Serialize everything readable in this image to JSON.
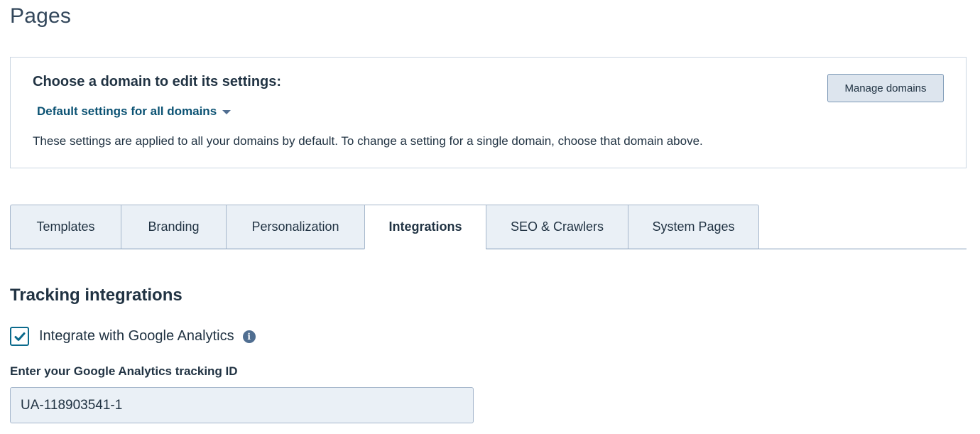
{
  "page": {
    "title": "Pages"
  },
  "domain_card": {
    "heading": "Choose a domain to edit its settings:",
    "selected_domain": "Default settings for all domains",
    "description": "These settings are applied to all your domains by default. To change a setting for a single domain, choose that domain above.",
    "manage_button": "Manage domains"
  },
  "tabs": [
    {
      "label": "Templates",
      "active": false
    },
    {
      "label": "Branding",
      "active": false
    },
    {
      "label": "Personalization",
      "active": false
    },
    {
      "label": "Integrations",
      "active": true
    },
    {
      "label": "SEO & Crawlers",
      "active": false
    },
    {
      "label": "System Pages",
      "active": false
    }
  ],
  "tracking": {
    "section_title": "Tracking integrations",
    "google_analytics": {
      "label": "Integrate with Google Analytics",
      "checked": true,
      "info_icon": "info-circle-icon"
    },
    "tracking_id_label": "Enter your Google Analytics tracking ID",
    "tracking_id_value": "UA-118903541-1"
  },
  "colors": {
    "accent": "#0b6a8c",
    "link": "#0b5273",
    "tab_bg": "#eaf0f6",
    "button_bg": "#dde5ee"
  }
}
